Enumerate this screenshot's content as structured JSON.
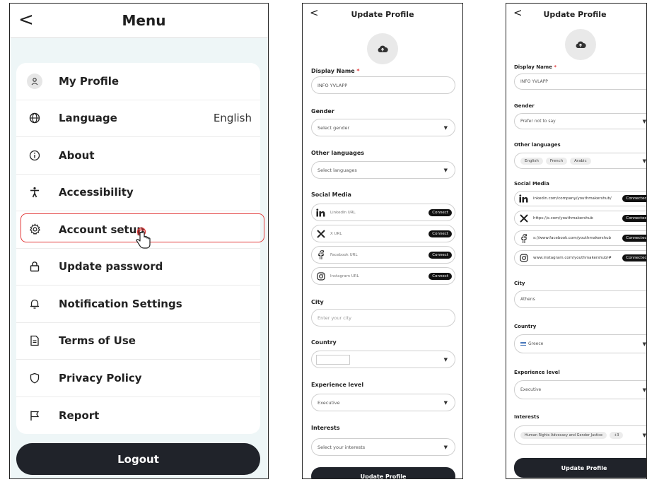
{
  "menu_screen": {
    "title": "Menu",
    "back_glyph": "<",
    "items": [
      {
        "label": "My Profile",
        "icon": "person-icon"
      },
      {
        "label": "Language",
        "icon": "globe-icon",
        "value": "English"
      },
      {
        "label": "About",
        "icon": "info-icon"
      },
      {
        "label": "Accessibility",
        "icon": "accessibility-icon"
      },
      {
        "label": "Account setup",
        "icon": "gear-icon"
      },
      {
        "label": "Update password",
        "icon": "lock-icon"
      },
      {
        "label": "Notification Settings",
        "icon": "bell-icon"
      },
      {
        "label": "Terms of Use",
        "icon": "document-icon"
      },
      {
        "label": "Privacy Policy",
        "icon": "shield-icon"
      },
      {
        "label": "Report",
        "icon": "flag-icon"
      }
    ],
    "logout_label": "Logout",
    "highlight_color": "#e23a3a"
  },
  "profile_empty": {
    "title": "Update Profile",
    "back_glyph": "<",
    "display_name_label": "Display Name",
    "required_mark": "*",
    "display_name_value": "INFO YVLAPP",
    "gender_label": "Gender",
    "gender_value": "Select gender",
    "languages_label": "Other languages",
    "languages_value": "Select languages",
    "social_label": "Social Media",
    "social": [
      {
        "icon": "linkedin-icon",
        "value": "LinkedIn URL",
        "button": "Connect"
      },
      {
        "icon": "x-icon",
        "value": "X URL",
        "button": "Connect"
      },
      {
        "icon": "facebook-icon",
        "value": "Facebook URL",
        "button": "Connect"
      },
      {
        "icon": "instagram-icon",
        "value": "Instagram URL",
        "button": "Connect"
      }
    ],
    "city_label": "City",
    "city_placeholder": "Enter your city",
    "country_label": "Country",
    "experience_label": "Experience level",
    "experience_value": "Executive",
    "interests_label": "Interests",
    "interests_value": "Select your interests",
    "update_button": "Update Profile"
  },
  "profile_filled": {
    "title": "Update Profile",
    "back_glyph": "<",
    "display_name_label": "Display Name",
    "required_mark": "*",
    "display_name_value": "INFO YVLAPP",
    "gender_label": "Gender",
    "gender_value": "Prefer not to say",
    "languages_label": "Other languages",
    "languages": [
      "English",
      "French",
      "Arabic"
    ],
    "social_label": "Social Media",
    "social": [
      {
        "icon": "linkedin-icon",
        "value": "inkedin.com/company/youthmakershub/",
        "button": "Connected"
      },
      {
        "icon": "x-icon",
        "value": "https://x.com/youthmakershub",
        "button": "Connected"
      },
      {
        "icon": "facebook-icon",
        "value": "s://www.facebook.com/youthmakershub",
        "button": "Connected"
      },
      {
        "icon": "instagram-icon",
        "value": "www.instagram.com/youthmakershub/#",
        "button": "Connected"
      }
    ],
    "city_label": "City",
    "city_value": "Athens",
    "country_label": "Country",
    "country_value": "Greece",
    "experience_label": "Experience level",
    "experience_value": "Executive",
    "interests_label": "Interests",
    "interest_chip": "Human Rights Advocacy and Gender Justice",
    "interest_more": "+3",
    "update_button": "Update Profile"
  }
}
